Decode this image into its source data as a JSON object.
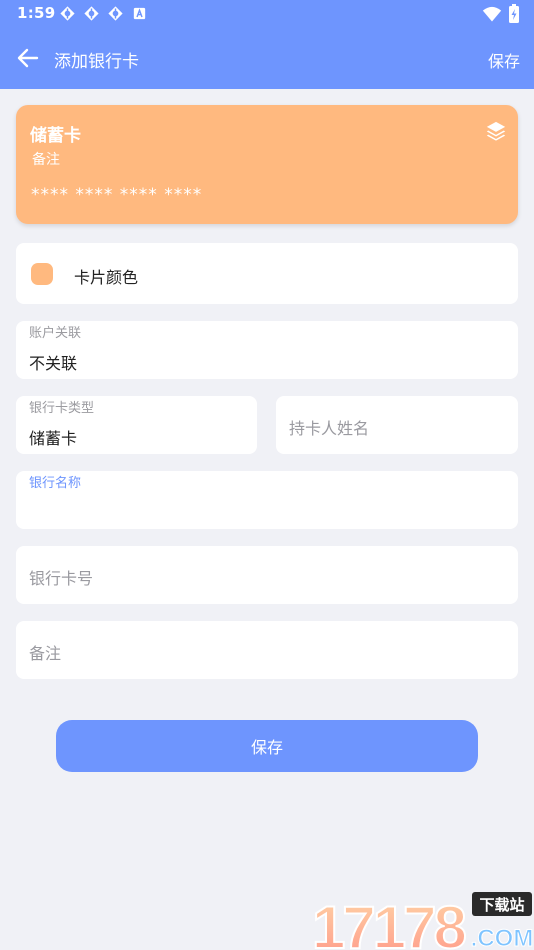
{
  "status_bar": {
    "time": "1:59",
    "left_icons": [
      "sync-icon",
      "sync-icon",
      "sync-icon",
      "font-a-icon"
    ],
    "right_icons": [
      "wifi-icon",
      "battery-charging-icon"
    ]
  },
  "app_bar": {
    "title": "添加银行卡",
    "save_label": "保存",
    "back_icon": "arrow-left-icon"
  },
  "card_preview": {
    "type": "储蓄卡",
    "note": "备注",
    "number_mask": "**** **** **** ****",
    "color": "#ffb97f",
    "icon": "layers-icon"
  },
  "form": {
    "card_color": {
      "label": "卡片颜色",
      "value": "#ffb97f"
    },
    "account_link": {
      "label": "账户关联",
      "value": "不关联"
    },
    "card_type": {
      "label": "银行卡类型",
      "value": "储蓄卡"
    },
    "holder_name": {
      "placeholder": "持卡人姓名"
    },
    "bank_name": {
      "label": "银行名称",
      "value": ""
    },
    "card_number": {
      "placeholder": "银行卡号"
    },
    "note": {
      "placeholder": "备注"
    }
  },
  "save_button": {
    "label": "保存"
  },
  "watermark": {
    "brand": "17178",
    "site": "下载站",
    "domain": ".COM"
  },
  "colors": {
    "primary": "#6e95fe",
    "card": "#ffb97f",
    "background": "#f0f1f6"
  }
}
